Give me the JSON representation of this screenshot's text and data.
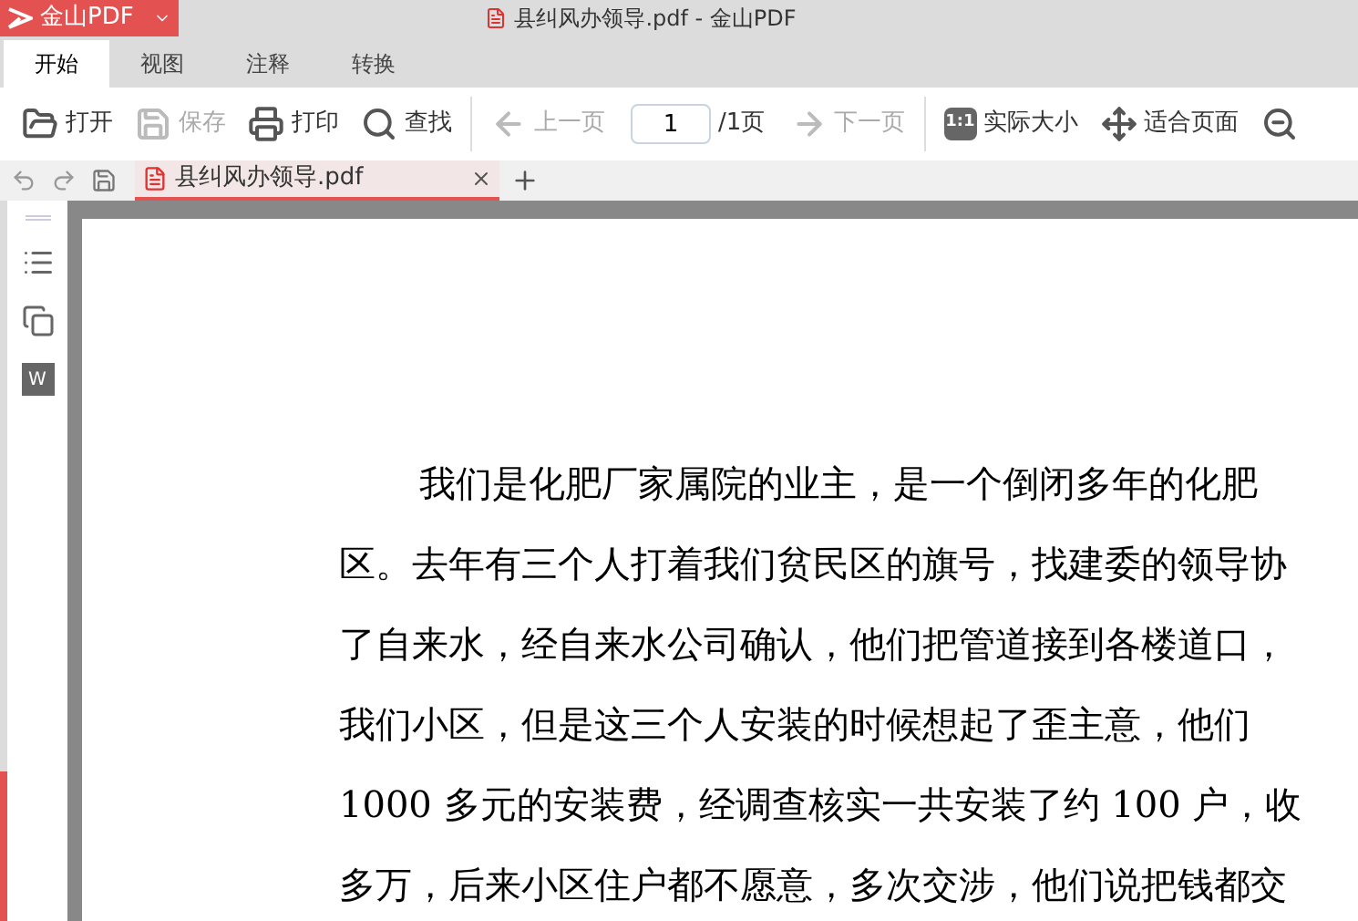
{
  "app_button": {
    "label": "金山PDF"
  },
  "window": {
    "title": "县纠风办领导.pdf - 金山PDF"
  },
  "ribbon_tabs": [
    {
      "label": "开始",
      "selected": true
    },
    {
      "label": "视图",
      "selected": false
    },
    {
      "label": "注释",
      "selected": false
    },
    {
      "label": "转换",
      "selected": false
    }
  ],
  "toolbar": {
    "groups": [
      [
        {
          "kind": "open",
          "label": "打开",
          "disabled": false
        },
        {
          "kind": "save",
          "label": "保存",
          "disabled": true
        },
        {
          "kind": "print",
          "label": "打印",
          "disabled": false
        },
        {
          "kind": "find",
          "label": "查找",
          "disabled": false
        }
      ],
      [
        {
          "kind": "prev",
          "label": "上一页",
          "disabled": true
        },
        {
          "kind": "page",
          "value": "1",
          "total": "/1页"
        },
        {
          "kind": "next",
          "label": "下一页",
          "disabled": true
        }
      ],
      [
        {
          "kind": "actual",
          "label": "实际大小",
          "glyph": "1:1",
          "disabled": false
        },
        {
          "kind": "fit",
          "label": "适合页面",
          "disabled": false
        },
        {
          "kind": "zoomout"
        }
      ]
    ]
  },
  "sidebar": {
    "word_glyph": "W"
  },
  "doc_tabs": [
    {
      "label": "县纠风办领导.pdf",
      "selected": true
    }
  ],
  "document": {
    "lines": [
      {
        "text": "我们是化肥厂家属院的业主，是一个倒闭多年的化肥",
        "indent": true
      },
      {
        "text": "区。去年有三个人打着我们贫民区的旗号，找建委的领导协",
        "indent": false
      },
      {
        "text": "了自来水，经自来水公司确认，他们把管道接到各楼道口，",
        "indent": false
      },
      {
        "text": "我们小区，但是这三个人安装的时候想起了歪主意，他们",
        "indent": false
      },
      {
        "text": "1000 多元的安装费，经调查核实一共安装了约 100 户，收",
        "indent": false
      },
      {
        "text": "多万，后来小区住户都不愿意，多次交涉，他们说把钱都交",
        "indent": false
      }
    ]
  }
}
